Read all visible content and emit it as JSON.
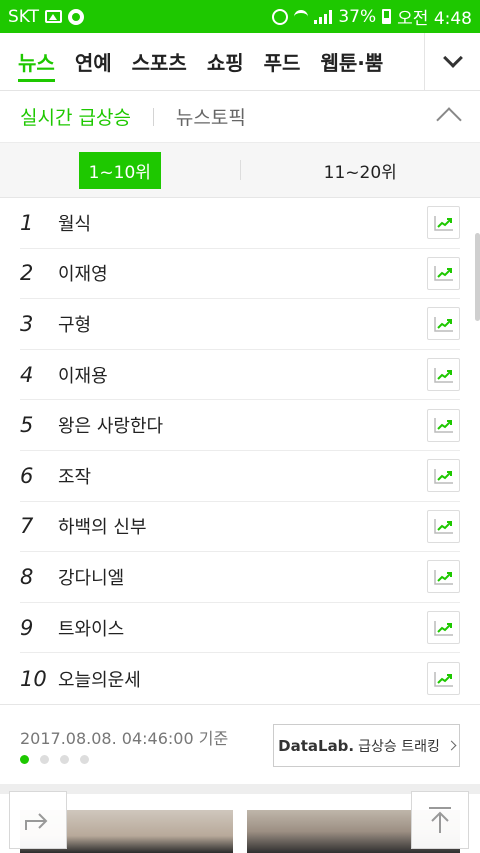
{
  "status_bar": {
    "carrier": "SKT",
    "battery": "37%",
    "time": "오전 4:48"
  },
  "category_nav": {
    "items": [
      "뉴스",
      "연예",
      "스포츠",
      "쇼핑",
      "푸드",
      "웹툰·뿜"
    ],
    "active_index": 0
  },
  "sub_tabs": {
    "items": [
      "실시간 급상승",
      "뉴스토픽"
    ],
    "active_index": 0
  },
  "range_tabs": {
    "items": [
      "1~10위",
      "11~20위"
    ],
    "active_index": 0
  },
  "rankings": [
    {
      "rank": "1",
      "keyword": "월식"
    },
    {
      "rank": "2",
      "keyword": "이재영"
    },
    {
      "rank": "3",
      "keyword": "구형"
    },
    {
      "rank": "4",
      "keyword": "이재용"
    },
    {
      "rank": "5",
      "keyword": "왕은 사랑한다"
    },
    {
      "rank": "6",
      "keyword": "조작"
    },
    {
      "rank": "7",
      "keyword": "하백의 신부"
    },
    {
      "rank": "8",
      "keyword": "강다니엘"
    },
    {
      "rank": "9",
      "keyword": "트와이스"
    },
    {
      "rank": "10",
      "keyword": "오늘의운세"
    }
  ],
  "footer": {
    "timestamp": "2017.08.08. 04:46:00 기준",
    "datalab_brand": "DataLab.",
    "datalab_text": "급상승 트래킹",
    "page_dots": 4,
    "active_dot": 0
  },
  "colors": {
    "brand": "#1ec800"
  },
  "icons": {
    "trend": "trend-chart-icon",
    "share": "share-icon",
    "scroll_top": "scroll-top-icon"
  }
}
